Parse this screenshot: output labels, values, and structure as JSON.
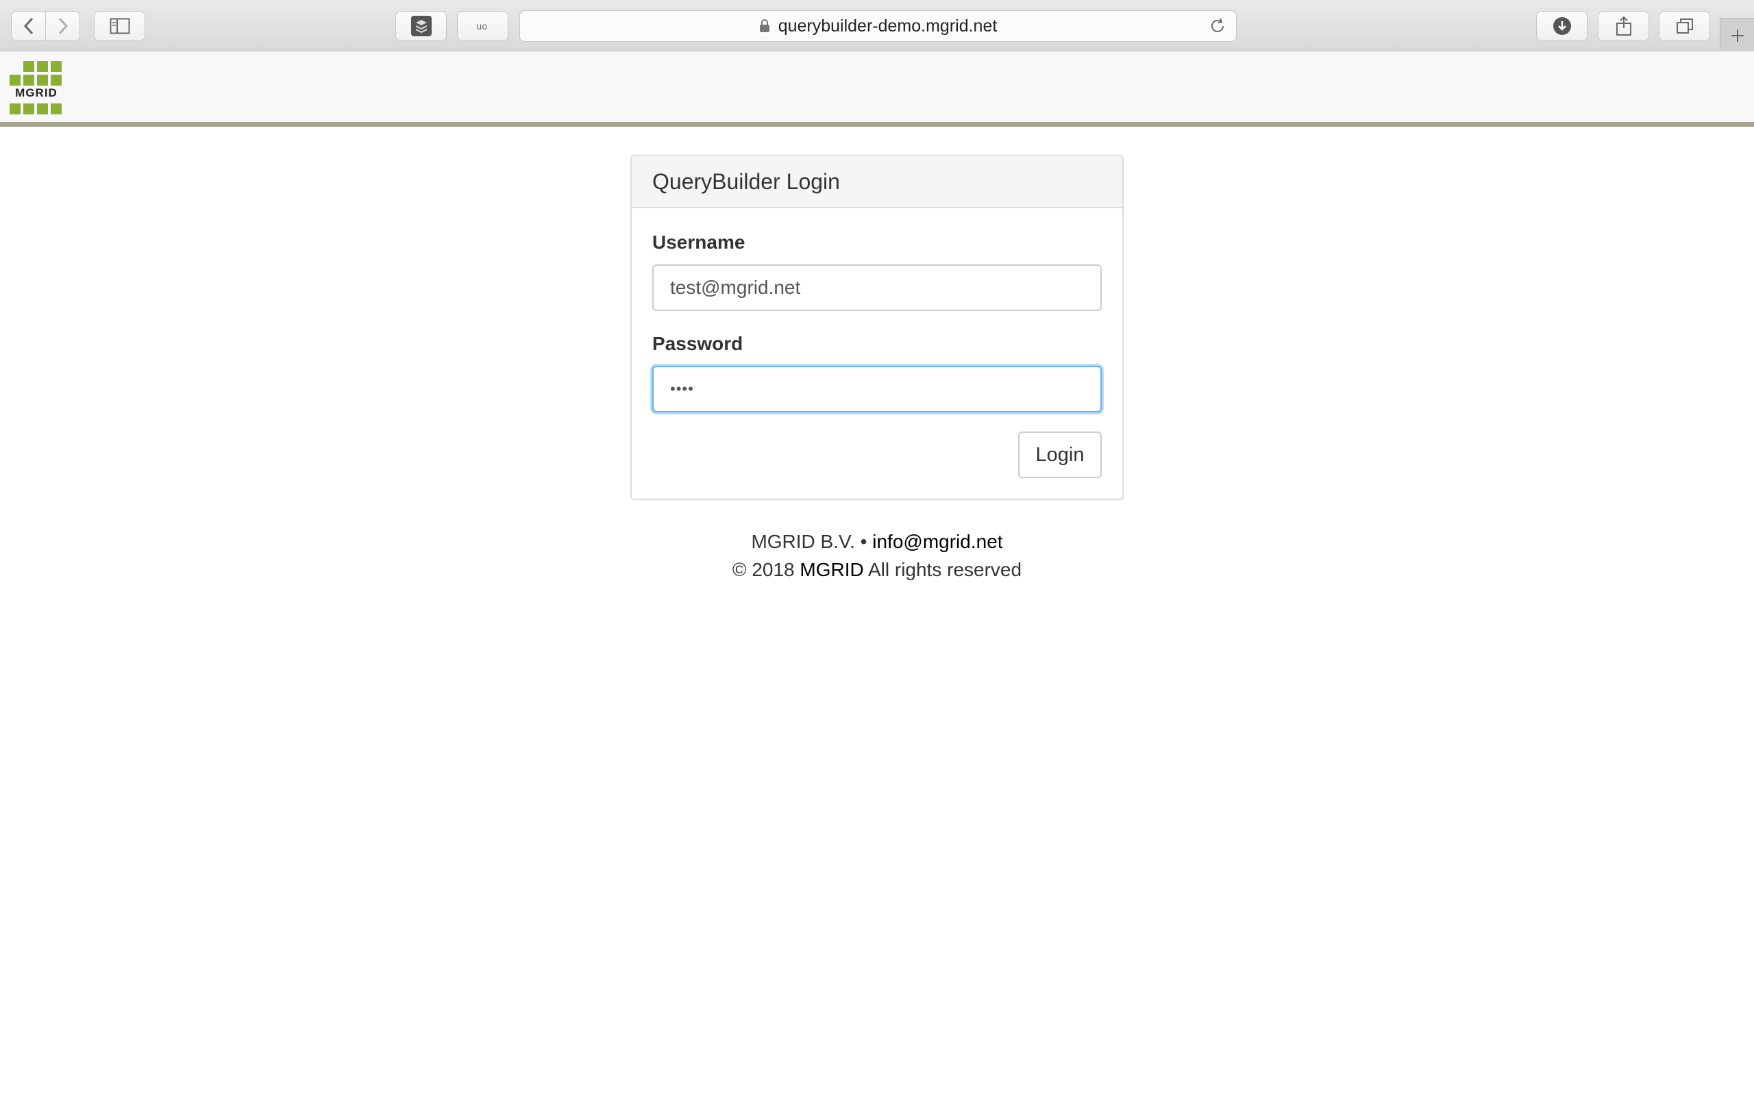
{
  "browser": {
    "url": "querybuilder-demo.mgrid.net"
  },
  "header": {
    "logo_text": "MGRID"
  },
  "login": {
    "title": "QueryBuilder Login",
    "username_label": "Username",
    "username_value": "test@mgrid.net",
    "password_label": "Password",
    "password_value": "••••",
    "login_button": "Login"
  },
  "footer": {
    "company": "MGRID B.V.",
    "separator": "•",
    "email": "info@mgrid.net",
    "copyright_prefix": "© 2018",
    "copyright_brand": "MGRID",
    "copyright_suffix": "All rights reserved"
  },
  "colors": {
    "logo_green": "#8ab02f",
    "focus_blue": "#66afe9"
  }
}
